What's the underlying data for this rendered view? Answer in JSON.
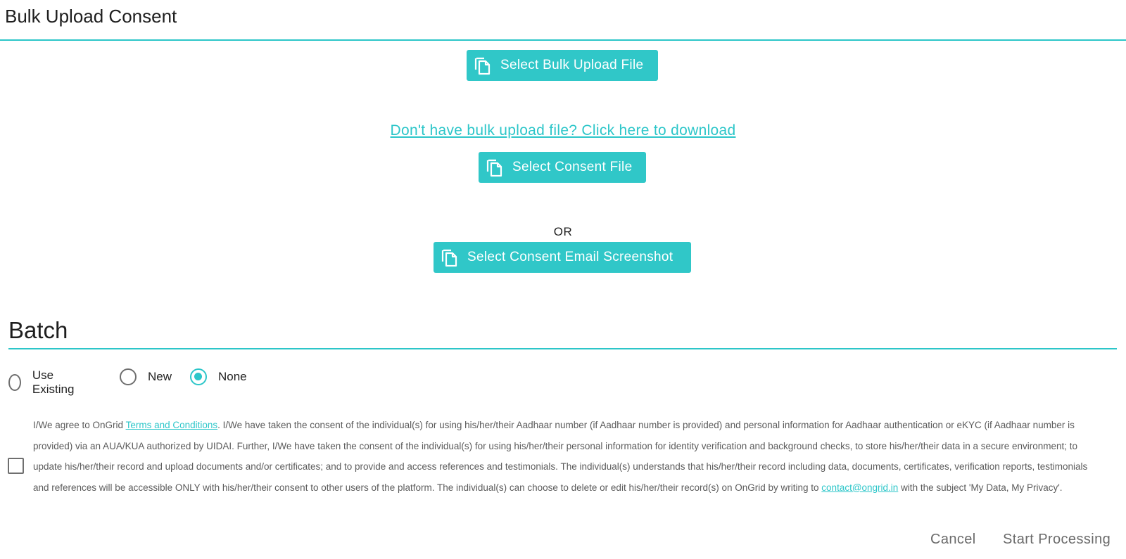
{
  "header": {
    "title": "Bulk Upload Consent"
  },
  "upload": {
    "bulk_button_label": "Select Bulk Upload File",
    "download_link_text": "Don't have bulk upload file? Click here to download",
    "consent_button_label": "Select Consent File",
    "or_label": "OR",
    "email_button_label": "Select Consent Email Screenshot"
  },
  "batch": {
    "title": "Batch",
    "options": [
      {
        "label": "Use Existing",
        "selected": false
      },
      {
        "label": "New",
        "selected": false
      },
      {
        "label": "None",
        "selected": true
      }
    ]
  },
  "consent": {
    "checked": false,
    "text_prefix": "I/We agree to OnGrid ",
    "terms_link": "Terms and Conditions",
    "text_body": ". I/We have taken the consent of the individual(s) for using his/her/their Aadhaar number (if Aadhaar number is provided) and personal information for Aadhaar authentication or eKYC (if Aadhaar number is provided) via an AUA/KUA authorized by UIDAI. Further, I/We have taken the consent of the individual(s) for using his/her/their personal information for identity verification and background checks, to store his/her/their data in a secure environment; to update his/her/their record and upload documents and/or certificates; and to provide and access references and testimonials. The individual(s) understands that his/her/their record including data, documents, certificates, verification reports, testimonials and references will be accessible ONLY with his/her/their consent to other users of the platform. The individual(s) can choose to delete or edit his/her/their record(s) on OnGrid by writing to ",
    "email_link": "contact@ongrid.in",
    "text_suffix": " with the subject 'My Data, My Privacy'."
  },
  "actions": {
    "cancel_label": "Cancel",
    "start_label": "Start Processing"
  },
  "colors": {
    "accent": "#2cc6c9",
    "button_bg": "#30c7c8"
  },
  "icons": {
    "upload_button": "copy-file-icon"
  }
}
